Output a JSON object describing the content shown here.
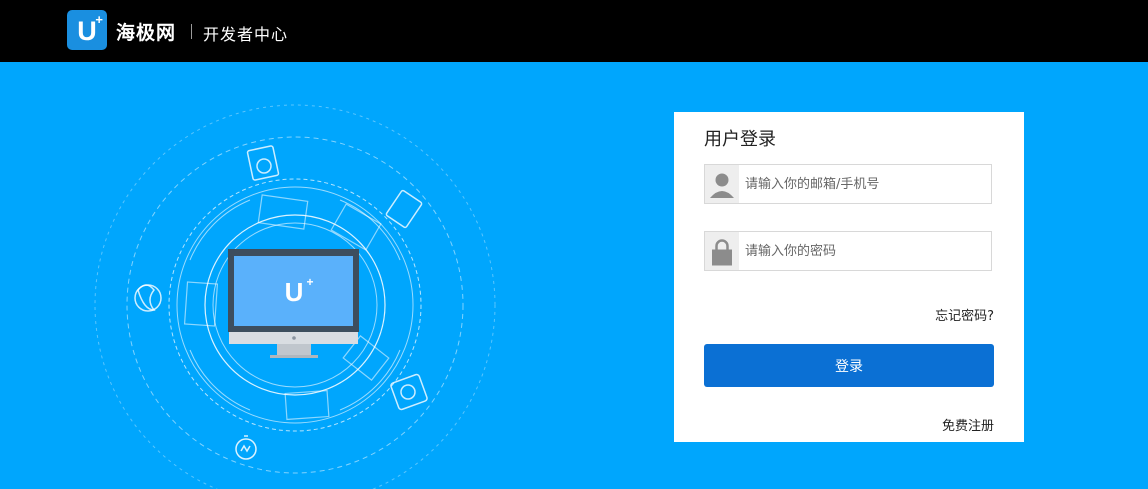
{
  "header": {
    "logo_letter": "U",
    "logo_plus": "+",
    "brand": "海极网",
    "subtitle": "开发者中心"
  },
  "illustration": {
    "screen_logo": "U",
    "screen_logo_plus": "+",
    "icons": [
      "washing-machine-icon",
      "tablet-icon",
      "air-conditioner-icon",
      "fan-icon",
      "watch-icon"
    ]
  },
  "login": {
    "title": "用户登录",
    "username_placeholder": "请输入你的邮箱/手机号",
    "password_placeholder": "请输入你的密码",
    "forgot": "忘记密码?",
    "submit": "登录",
    "register": "免费注册"
  },
  "colors": {
    "background": "#00a6fd",
    "topbar": "#000000",
    "button": "#0b70d4",
    "logo": "#1a8fe0"
  }
}
